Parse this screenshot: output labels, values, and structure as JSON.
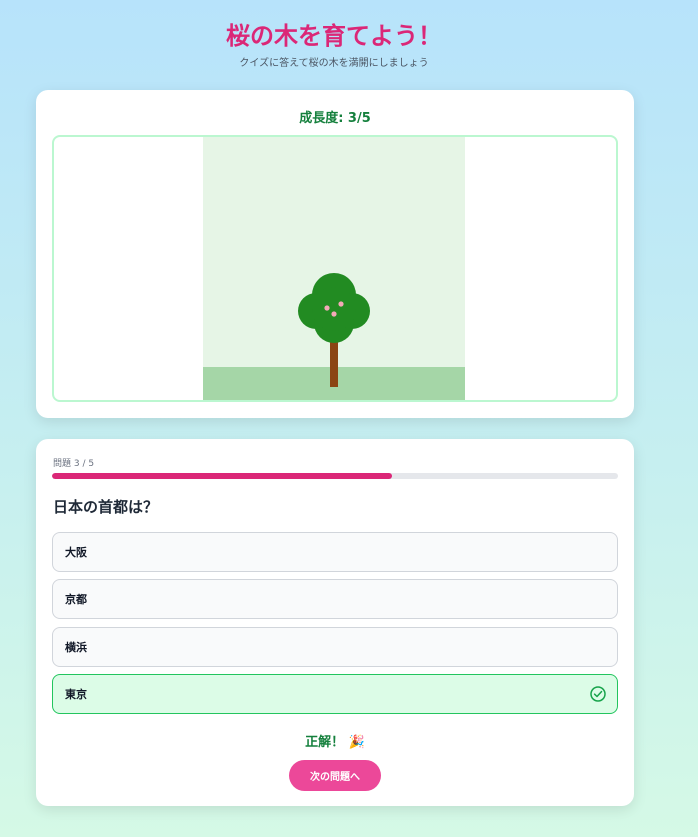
{
  "header": {
    "title": "桜の木を育てよう！",
    "subtitle": "クイズに答えて桜の木を満開にしましょう"
  },
  "growth": {
    "label": "成長度: 3/5",
    "level": 3,
    "max": 5
  },
  "quiz": {
    "counter": "問題 3 / 5",
    "progress_fraction": 0.6,
    "question": "日本の首都は？",
    "options": [
      {
        "label": "大阪",
        "state": "default"
      },
      {
        "label": "京都",
        "state": "default"
      },
      {
        "label": "横浜",
        "state": "default"
      },
      {
        "label": "東京",
        "state": "correct"
      }
    ],
    "result": "正解！ 🎉",
    "next_button": "次の問題へ"
  },
  "colors": {
    "accent": "#db2777",
    "button": "#ec4899",
    "success": "#15803d",
    "correct_bg": "#dcfce7",
    "correct_border": "#22c55e"
  }
}
